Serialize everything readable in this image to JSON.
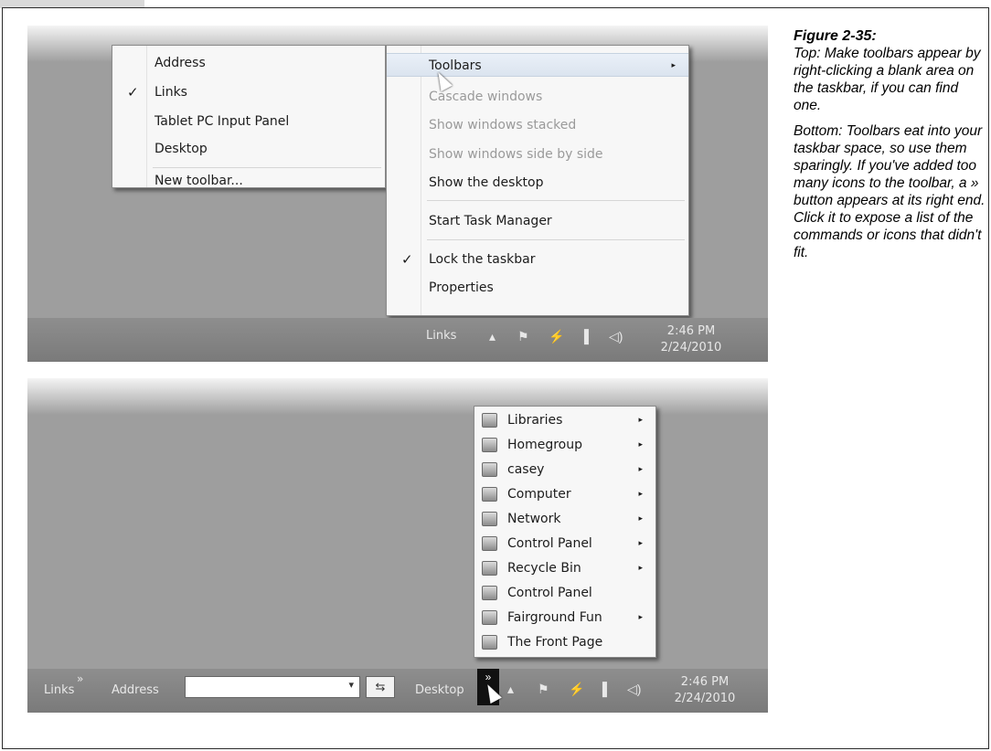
{
  "caption": {
    "figure_label": "Figure 2-35:",
    "top_text": "Top: Make toolbars appear by right-clicking a blank area on the taskbar, if you can find one.",
    "bottom_text": "Bottom: Toolbars eat into your taskbar space, so use them sparingly. If you've added too many icons to the toolbar, a » button appears at its right end. Click it to expose a list of the commands or icons that didn't fit."
  },
  "top_screenshot": {
    "toolbars_submenu": {
      "items": [
        {
          "label": "Address",
          "checked": false
        },
        {
          "label": "Links",
          "checked": true
        },
        {
          "label": "Tablet PC Input Panel",
          "checked": false
        },
        {
          "label": "Desktop",
          "checked": false
        },
        {
          "label": "New toolbar...",
          "checked": false
        }
      ],
      "check_glyph": "✓"
    },
    "context_menu": {
      "items": [
        {
          "label": "Toolbars",
          "state": "highlighted",
          "submenu": true
        },
        {
          "label": "Cascade windows",
          "state": "disabled"
        },
        {
          "label": "Show windows stacked",
          "state": "disabled"
        },
        {
          "label": "Show windows side by side",
          "state": "disabled"
        },
        {
          "label": "Show the desktop",
          "state": "enabled"
        },
        {
          "label": "Start Task Manager",
          "state": "enabled"
        },
        {
          "label": "Lock the taskbar",
          "state": "enabled",
          "checked": true
        },
        {
          "label": "Properties",
          "state": "enabled"
        }
      ],
      "submenu_arrow": "▸"
    },
    "taskbar": {
      "links_label": "Links",
      "clock_time": "2:46 PM",
      "clock_date": "2/24/2010"
    }
  },
  "bottom_screenshot": {
    "taskbar": {
      "links_label": "Links",
      "links_chevron": "»",
      "address_label": "Address",
      "address_value": "",
      "address_dropdown_glyph": "▾",
      "go_button_glyph": "⇆",
      "desktop_label": "Desktop",
      "overflow_chevron": "»",
      "clock_time": "2:46 PM",
      "clock_date": "2/24/2010"
    },
    "overflow_menu": {
      "items": [
        {
          "label": "Libraries",
          "submenu": true,
          "icon": "libraries-icon"
        },
        {
          "label": "Homegroup",
          "submenu": true,
          "icon": "homegroup-icon"
        },
        {
          "label": "casey",
          "submenu": true,
          "icon": "user-folder-icon"
        },
        {
          "label": "Computer",
          "submenu": true,
          "icon": "computer-icon"
        },
        {
          "label": "Network",
          "submenu": true,
          "icon": "network-icon"
        },
        {
          "label": "Control Panel",
          "submenu": true,
          "icon": "control-panel-icon"
        },
        {
          "label": "Recycle Bin",
          "submenu": true,
          "icon": "recycle-bin-icon"
        },
        {
          "label": "Control Panel",
          "submenu": false,
          "icon": "control-panel-icon"
        },
        {
          "label": "Fairground Fun",
          "submenu": true,
          "icon": "folder-icon"
        },
        {
          "label": "The Front Page",
          "submenu": false,
          "icon": "document-icon"
        }
      ],
      "submenu_arrow": "▸"
    }
  },
  "tray_icons": [
    "show-hidden-icons-icon",
    "action-center-flag-icon",
    "power-icon",
    "network-signal-icon",
    "volume-icon"
  ],
  "tray_glyphs": {
    "up": "▴",
    "flag": "⚑",
    "power": "⚡",
    "signal": "▐",
    "volume": "◁)"
  }
}
